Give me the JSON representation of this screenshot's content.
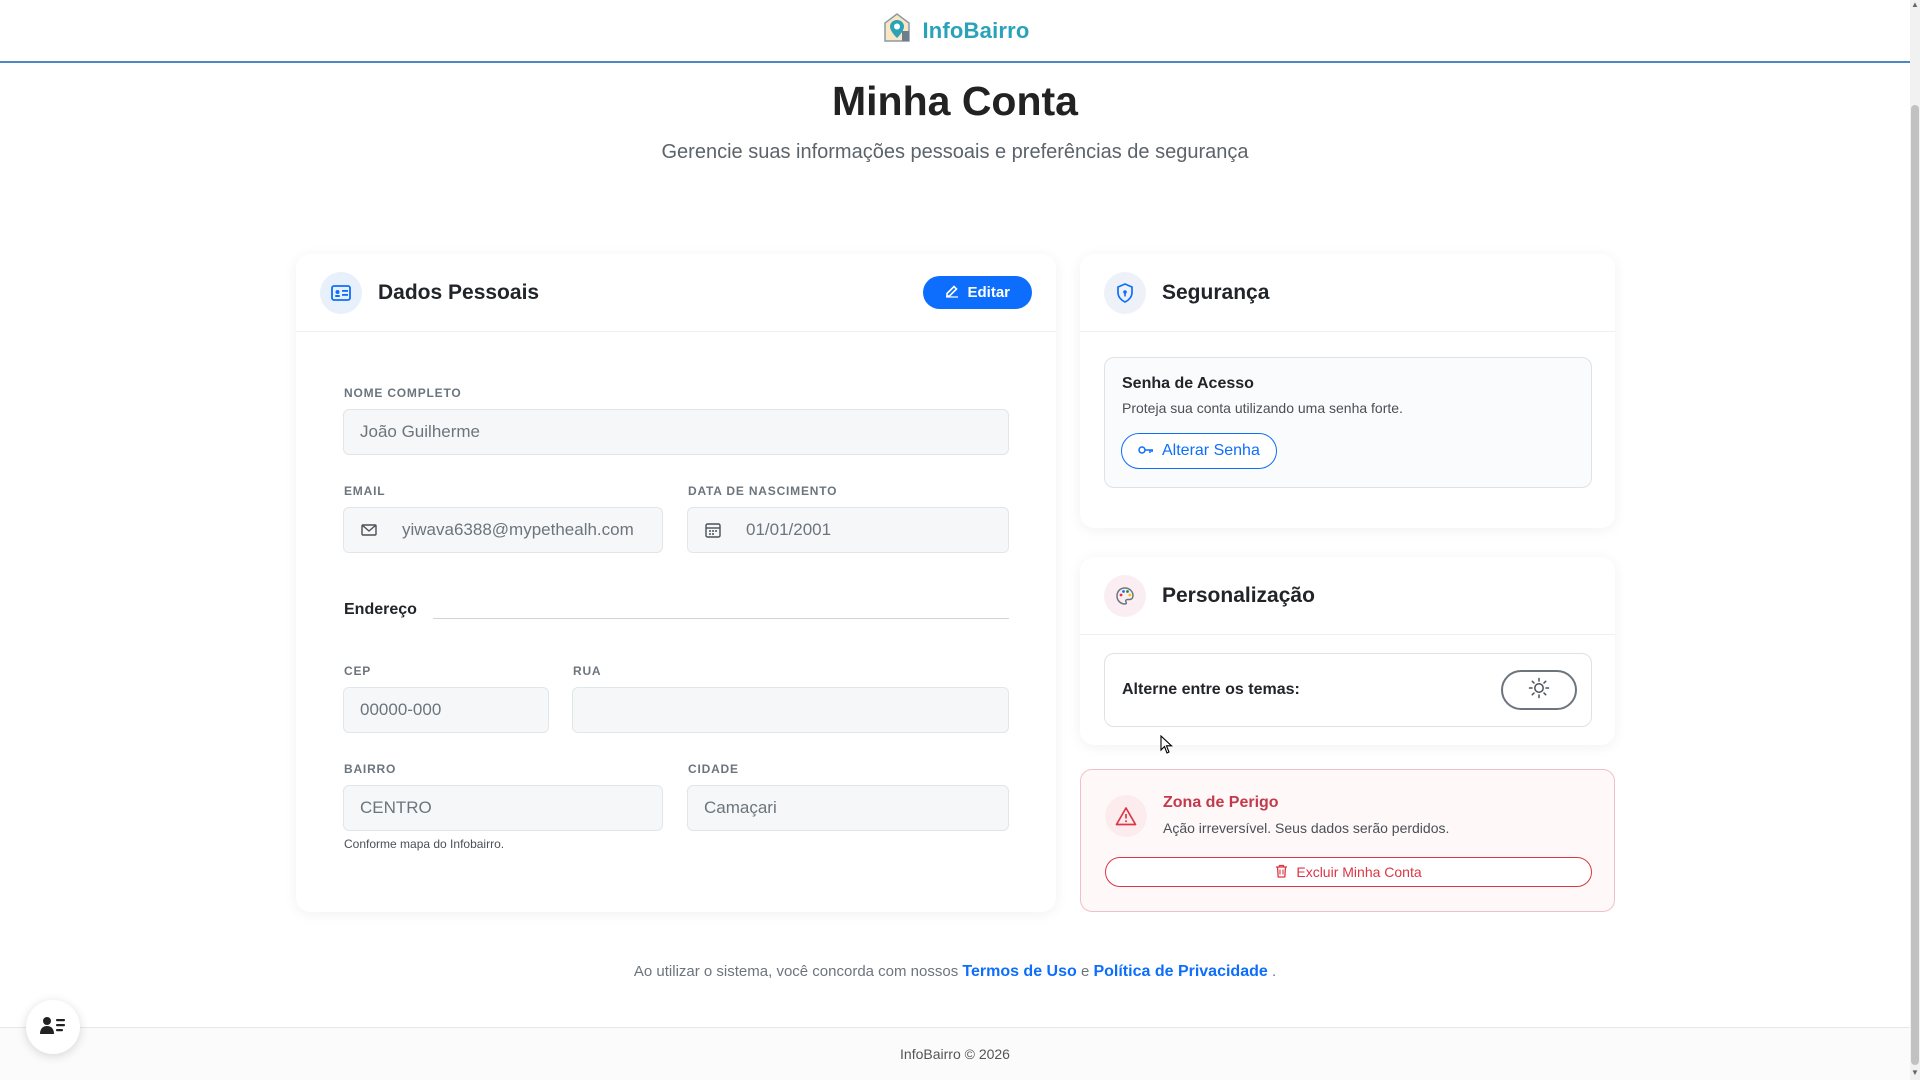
{
  "header": {
    "brand_name": "InfoBairro",
    "logo_icon": "map-pin-building-icon"
  },
  "hero": {
    "title": "Minha Conta",
    "subtitle": "Gerencie suas informações pessoais e preferências de segurança"
  },
  "personal": {
    "title": "Dados Pessoais",
    "icon": "id-card-icon",
    "edit_label": "Editar",
    "name_label": "NOME COMPLETO",
    "name_value": "João Guilherme",
    "email_label": "EMAIL",
    "email_value": "yiwava6388@mypethealh.com",
    "birth_label": "DATA DE NASCIMENTO",
    "birth_value": "01/01/2001",
    "address_title": "Endereço",
    "cep_label": "CEP",
    "cep_placeholder": "00000-000",
    "street_label": "RUA",
    "street_value": "",
    "district_label": "BAIRRO",
    "district_value": "CENTRO",
    "district_hint": "Conforme mapa do Infobairro.",
    "city_label": "CIDADE",
    "city_value": "Camaçari"
  },
  "security": {
    "title": "Segurança",
    "icon": "shield-icon",
    "password_title": "Senha de Acesso",
    "password_desc": "Proteja sua conta utilizando uma senha forte.",
    "change_password_label": "Alterar Senha"
  },
  "personalization": {
    "title": "Personalização",
    "icon": "palette-icon",
    "theme_label": "Alterne entre os temas:",
    "theme_icon": "sun-icon"
  },
  "danger": {
    "title": "Zona de Perigo",
    "desc": "Ação irreversível. Seus dados serão perdidos.",
    "delete_label": "Excluir Minha Conta",
    "icon": "warning-triangle-icon"
  },
  "footer": {
    "terms_prefix": "Ao utilizar o sistema, você concorda com nossos",
    "terms_link": "Termos de Uso",
    "terms_and": "e",
    "privacy_link": "Política de Privacidade",
    "terms_suffix": ".",
    "copyright": "InfoBairro © 2026"
  },
  "colors": {
    "primary": "#0d6efd",
    "brand": "#2aa3b8",
    "danger": "#dc3545"
  }
}
